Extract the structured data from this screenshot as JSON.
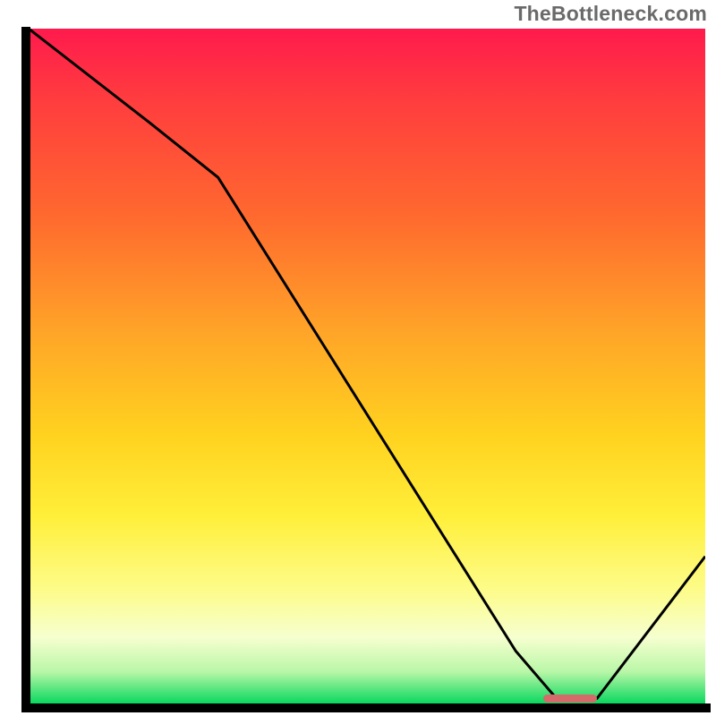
{
  "attribution": "TheBottleneck.com",
  "chart_data": {
    "type": "line",
    "title": "",
    "xlabel": "",
    "ylabel": "",
    "xlim": [
      0,
      100
    ],
    "ylim": [
      0,
      100
    ],
    "grid": false,
    "legend": false,
    "series": [
      {
        "name": "bottleneck-curve",
        "x": [
          0,
          18,
          28,
          72,
          78,
          84,
          100
        ],
        "y": [
          100,
          86,
          78,
          8,
          1,
          1,
          22
        ],
        "color": "#000000"
      }
    ],
    "optimal_marker": {
      "x_start_pct": 76,
      "x_end_pct": 84,
      "y_pct": 1,
      "color": "#d46a6a"
    },
    "background_gradient": {
      "top": "#ff1a4d",
      "upper_mid": "#ff6a2e",
      "mid": "#ffd21f",
      "lower_mid": "#fdfc8a",
      "bottom": "#00d65a"
    }
  }
}
